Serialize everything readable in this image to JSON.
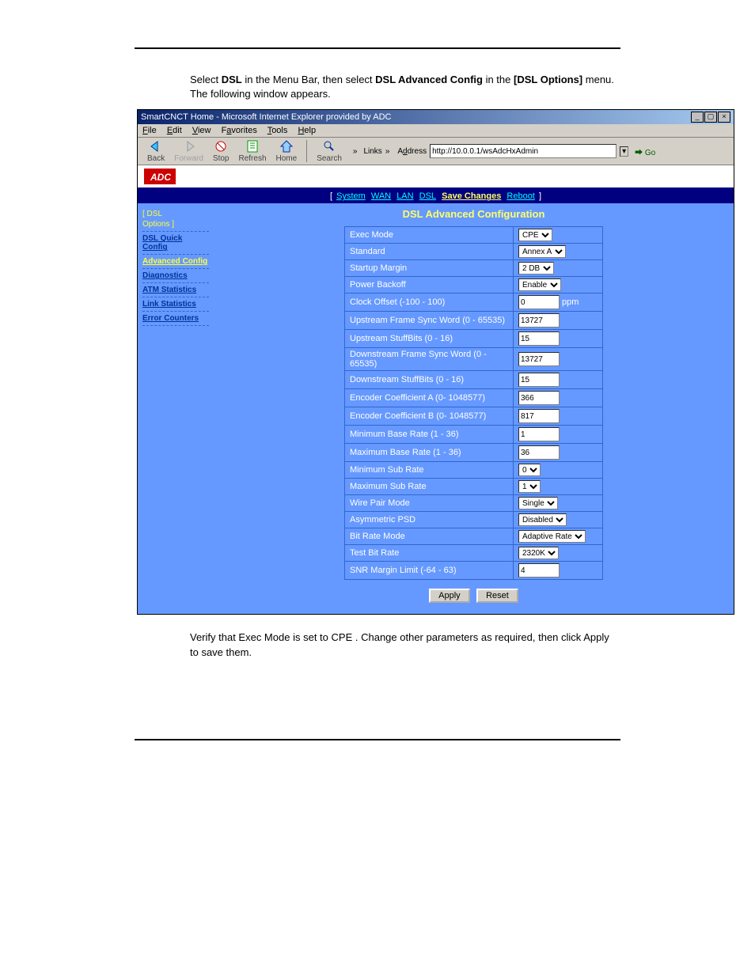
{
  "intro": {
    "p1_a": "Select ",
    "p1_b": "DSL",
    "p1_c": " in the Menu Bar, then select ",
    "p1_d": "DSL Advanced Config",
    "p1_e": " in the ",
    "p1_f": "[DSL Options]",
    "p1_g": " menu. The following window appears."
  },
  "browser": {
    "title": "SmartCNCT Home - Microsoft Internet Explorer provided by ADC",
    "menu": [
      "File",
      "Edit",
      "View",
      "Favorites",
      "Tools",
      "Help"
    ],
    "toolbar": {
      "back": "Back",
      "forward": "Forward",
      "stop": "Stop",
      "refresh": "Refresh",
      "home": "Home",
      "search": "Search",
      "links": "Links",
      "address_label": "Address",
      "address": "http://10.0.0.1/wsAdcHxAdmin",
      "go": "Go"
    }
  },
  "logo": "ADC",
  "topnav": {
    "lb": "[ ",
    "system": "System",
    "wan": "WAN",
    "lan": "LAN",
    "dsl": "DSL",
    "save": "Save Changes",
    "reboot": "Reboot",
    "rb": " ]"
  },
  "sidebar": {
    "hdr1": "[ DSL",
    "hdr2": "Options ]",
    "items": [
      {
        "label": "DSL Quick Config",
        "active": false
      },
      {
        "label": "Advanced Config",
        "active": true
      },
      {
        "label": "Diagnostics",
        "active": false
      },
      {
        "label": "ATM Statistics",
        "active": false
      },
      {
        "label": "Link Statistics",
        "active": false
      },
      {
        "label": "Error Counters",
        "active": false
      }
    ]
  },
  "page_title": "DSL Advanced Configuration",
  "rows": [
    {
      "label": "Exec Mode",
      "type": "select",
      "value": "CPE"
    },
    {
      "label": "Standard",
      "type": "select",
      "value": "Annex A"
    },
    {
      "label": "Startup Margin",
      "type": "select",
      "value": "2 DB"
    },
    {
      "label": "Power Backoff",
      "type": "select",
      "value": "Enable"
    },
    {
      "label": "Clock Offset (-100 - 100)",
      "type": "text",
      "value": "0",
      "unit": "ppm"
    },
    {
      "label": "Upstream Frame Sync Word (0 - 65535)",
      "type": "text",
      "value": "13727"
    },
    {
      "label": "Upstream StuffBits (0 - 16)",
      "type": "text",
      "value": "15"
    },
    {
      "label": "Downstream Frame Sync Word (0 - 65535)",
      "type": "text",
      "value": "13727"
    },
    {
      "label": "Downstream StuffBits (0 - 16)",
      "type": "text",
      "value": "15"
    },
    {
      "label": "Encoder Coefficient A (0- 1048577)",
      "type": "text",
      "value": "366"
    },
    {
      "label": "Encoder Coefficient B (0- 1048577)",
      "type": "text",
      "value": "817"
    },
    {
      "label": "Minimum Base Rate (1 - 36)",
      "type": "text",
      "value": "1"
    },
    {
      "label": "Maximum Base Rate (1 - 36)",
      "type": "text",
      "value": "36"
    },
    {
      "label": "Minimum Sub Rate",
      "type": "select",
      "value": "0"
    },
    {
      "label": "Maximum Sub Rate",
      "type": "select",
      "value": "1"
    },
    {
      "label": "Wire Pair Mode",
      "type": "select",
      "value": "Single"
    },
    {
      "label": "Asymmetric PSD",
      "type": "select",
      "value": "Disabled"
    },
    {
      "label": "Bit Rate Mode",
      "type": "select",
      "value": "Adaptive Rate"
    },
    {
      "label": "Test Bit Rate",
      "type": "select",
      "value": "2320K"
    },
    {
      "label": "SNR Margin Limit (-64 - 63)",
      "type": "text",
      "value": "4"
    }
  ],
  "buttons": {
    "apply": "Apply",
    "reset": "Reset"
  },
  "closing": {
    "a": "Verify that ",
    "b": "Exec Mode",
    "c": " is set to ",
    "d": "CPE",
    "e": ". Change other parameters as required, then click ",
    "f": "Apply",
    "g": " to save them."
  }
}
